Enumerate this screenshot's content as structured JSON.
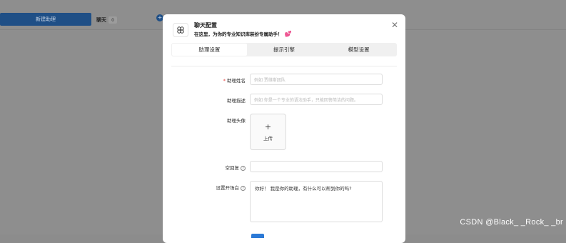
{
  "background": {
    "new_assistant_label": "新建助理",
    "chat_label": "聊天",
    "chat_count": "0",
    "add_icon": "plus-circle-icon"
  },
  "modal": {
    "title": "聊天配置",
    "subtitle": "在这里，为你的专业知识库装扮专属助手！",
    "icon": "assistant-icon",
    "tabs": [
      {
        "label": "助理设置",
        "active": true
      },
      {
        "label": "提示引擎",
        "active": false
      },
      {
        "label": "模型设置",
        "active": false
      }
    ],
    "form": {
      "name_label": "助理姓名",
      "name_placeholder": "例如 贾维斯团队",
      "desc_label": "助理描述",
      "desc_placeholder": "例如 你是一个专业的语法助手，只能回答简洁的问题。",
      "avatar_label": "助理头像",
      "upload_label": "上传",
      "empty_reply_label": "空回复",
      "empty_reply_value": "",
      "opening_label": "设置开场白",
      "opening_value": "你好！ 我是你的助理，有什么可以帮到你的吗?"
    }
  },
  "watermark": "CSDN @Black_ _Rock_ _br",
  "colors": {
    "overlay": "#8e8e8e",
    "primary": "#2b79d6",
    "required": "#e53935"
  }
}
